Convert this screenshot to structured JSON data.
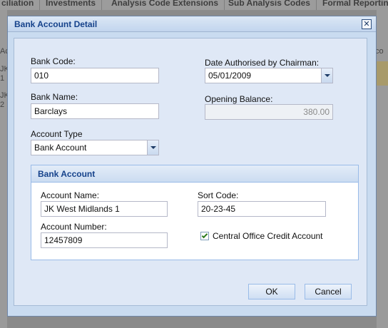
{
  "background": {
    "tabs": [
      "ciliation",
      "Investments",
      "Analysis Code Extensions",
      "Sub Analysis Codes",
      "Formal Reporting"
    ],
    "side_fragments": [
      "Ac",
      "JK",
      "1",
      "JK",
      "2"
    ],
    "right_fragment": "co"
  },
  "dialog": {
    "title": "Bank Account Detail",
    "close_glyph": "✕",
    "bank_code": {
      "label": "Bank Code:",
      "value": "010"
    },
    "bank_name": {
      "label": "Bank Name:",
      "value": "Barclays"
    },
    "account_type": {
      "label": "Account Type",
      "value": "Bank Account"
    },
    "date_authorised": {
      "label": "Date Authorised by Chairman:",
      "value": "05/01/2009"
    },
    "opening_balance": {
      "label": "Opening Balance:",
      "value": "380.00"
    },
    "bank_account_section": {
      "title": "Bank Account",
      "account_name": {
        "label": "Account Name:",
        "value": "JK West Midlands 1"
      },
      "account_number": {
        "label": "Account Number:",
        "value": "12457809"
      },
      "sort_code": {
        "label": "Sort Code:",
        "value": "20-23-45"
      },
      "central_office": {
        "label": "Central Office Credit Account",
        "checked": true
      }
    },
    "buttons": {
      "ok": "OK",
      "cancel": "Cancel"
    }
  },
  "colors": {
    "header_text": "#15428b",
    "dialog_bg": "#dfe8f6",
    "border": "#99bbe8"
  },
  "icons": {
    "close": "close-icon",
    "dropdown": "chevron-down-icon",
    "check": "check-icon"
  }
}
